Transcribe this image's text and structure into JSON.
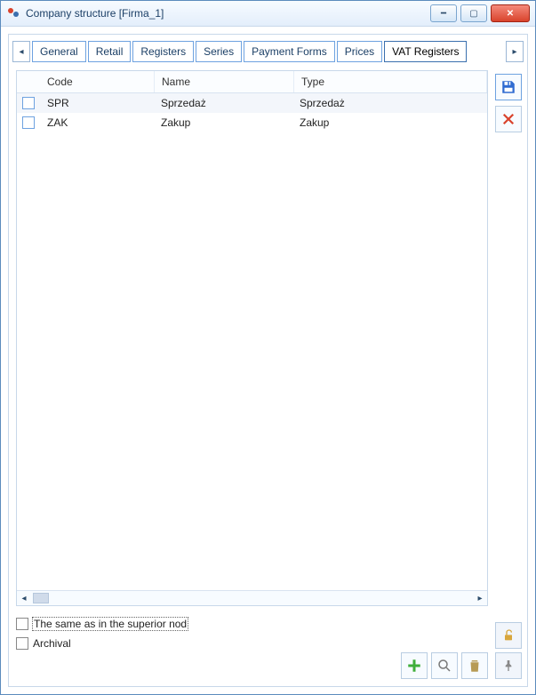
{
  "window": {
    "title": "Company structure [Firma_1]"
  },
  "tabs": {
    "items": [
      {
        "label": "General"
      },
      {
        "label": "Retail"
      },
      {
        "label": "Registers"
      },
      {
        "label": "Series"
      },
      {
        "label": "Payment Forms"
      },
      {
        "label": "Prices"
      },
      {
        "label": "VAT Registers"
      }
    ],
    "active_index": 6
  },
  "grid": {
    "columns": {
      "code": "Code",
      "name": "Name",
      "type": "Type"
    },
    "rows": [
      {
        "code": "SPR",
        "name": "Sprzedaż",
        "type": "Sprzedaż"
      },
      {
        "code": "ZAK",
        "name": "Zakup",
        "type": "Zakup"
      }
    ]
  },
  "footer": {
    "same_as_superior": "The same as in the superior nod",
    "archival": "Archival"
  },
  "icons": {
    "save": "save-icon",
    "delete": "delete-icon",
    "add": "plus-icon",
    "search": "magnifier-icon",
    "trash": "trash-icon",
    "lock": "lock-open-icon",
    "thumb": "pin-icon"
  }
}
